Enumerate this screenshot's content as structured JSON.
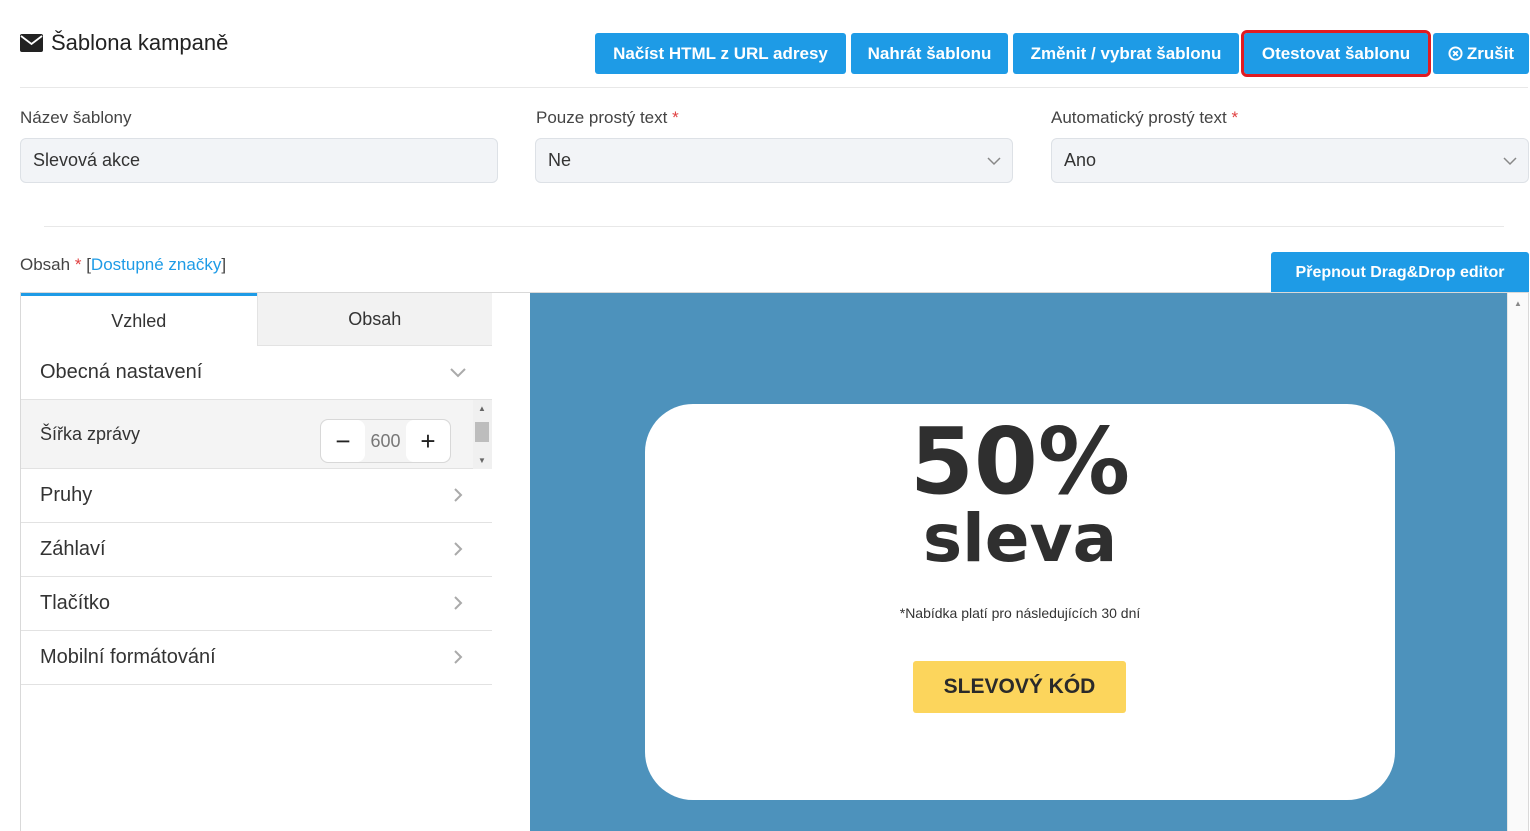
{
  "header": {
    "title": "Šablona kampaně",
    "buttons": {
      "load_html": "Načíst HTML z URL adresy",
      "upload": "Nahrát šablonu",
      "change": "Změnit / vybrat šablonu",
      "test": "Otestovat šablonu",
      "cancel": "Zrušit"
    }
  },
  "form": {
    "name_label": "Název šablony",
    "name_value": "Slevová akce",
    "plain_label": "Pouze prostý text",
    "plain_value": "Ne",
    "auto_label": "Automatický prostý text",
    "auto_value": "Ano",
    "required_mark": "*"
  },
  "content": {
    "label": "Obsah",
    "required_mark": "*",
    "bracket_open": "[",
    "tags_link": "Dostupné značky",
    "bracket_close": "]",
    "dragdrop_button": "Přepnout Drag&Drop editor"
  },
  "editor": {
    "tabs": [
      "Vzhled",
      "Obsah"
    ],
    "general_settings": "Obecná nastavení",
    "width_label": "Šířka zprávy",
    "width_value": "600",
    "minus": "−",
    "plus": "+",
    "sections": [
      "Pruhy",
      "Záhlaví",
      "Tlačítko",
      "Mobilní formátování"
    ]
  },
  "preview": {
    "percent": "50%",
    "sleva": "sleva",
    "note": "*Nabídka platí pro následujících 30 dní",
    "code_button": "SLEVOVÝ KÓD",
    "background": "#4d92bc",
    "button_color": "#fcd55c"
  },
  "colors": {
    "accent": "#1e9be6",
    "highlight_outline": "#e01b22"
  }
}
